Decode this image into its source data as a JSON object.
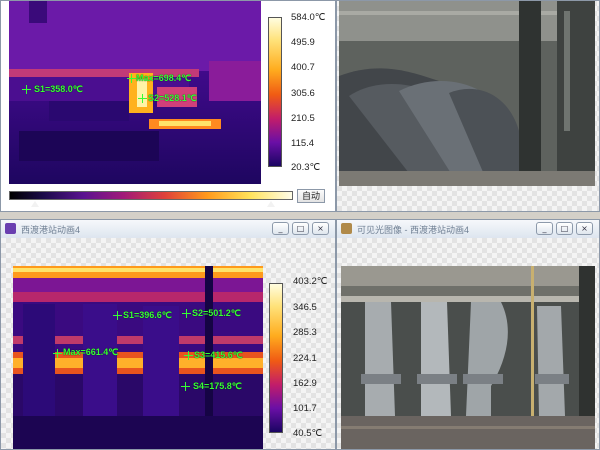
{
  "top_left": {
    "scale": {
      "max": "584.0℃",
      "ticks": [
        "495.9",
        "400.7",
        "305.6",
        "210.5",
        "115.4"
      ],
      "min": "20.3℃"
    },
    "markers": {
      "max": "Max=698.4℃",
      "s1": "S1=358.0℃",
      "s2": "S2=528.1℃"
    },
    "auto_button": "自动"
  },
  "bottom_left": {
    "title": "西渡港站动画4",
    "scale": {
      "max": "403.2℃",
      "ticks": [
        "346.5",
        "285.3",
        "224.1",
        "162.9",
        "101.7"
      ],
      "min": "40.5℃"
    },
    "markers": {
      "s1": "S1=396.6℃",
      "s2": "S2=501.2℃",
      "max": "Max=661.4℃",
      "s3": "S3=415.6℃",
      "s4": "S4=175.8℃"
    },
    "buttons": {
      "minimize": "_",
      "maximize": "□",
      "close": "×"
    }
  },
  "bottom_right": {
    "title": "可见光图像 - 西渡港站动画4",
    "buttons": {
      "minimize": "_",
      "maximize": "□",
      "close": "×"
    }
  },
  "colors": {
    "marker_green": "#35ff35",
    "title_text": "#6f7f93"
  }
}
